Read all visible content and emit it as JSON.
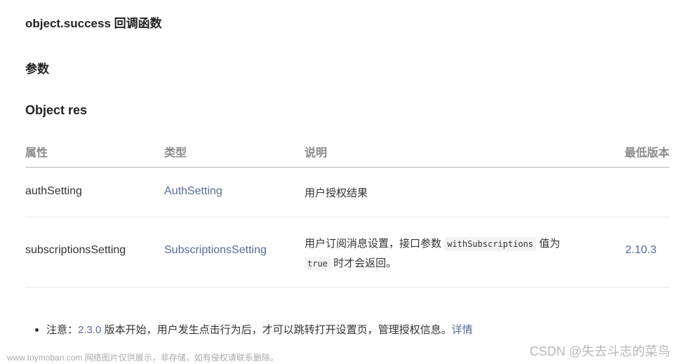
{
  "headings": {
    "callback": "object.success 回调函数",
    "params": "参数",
    "object": "Object res"
  },
  "table": {
    "headers": [
      "属性",
      "类型",
      "说明",
      "最低版本"
    ],
    "rows": [
      {
        "name": "authSetting",
        "type": "AuthSetting",
        "desc": "用户授权结果",
        "version": ""
      },
      {
        "name": "subscriptionsSetting",
        "type": "SubscriptionsSetting",
        "desc_part1": "用户订阅消息设置，接口参数",
        "desc_code1": "withSubscriptions",
        "desc_part2": "值为",
        "desc_code2": "true",
        "desc_part3": "时才会返回。",
        "version": "2.10.3"
      }
    ]
  },
  "note": {
    "prefix": "注意：",
    "version_link": "2.3.0",
    "text": "版本开始，用户发生点击行为后，才可以跳转打开设置页，管理授权信息。",
    "detail_link": "详情"
  },
  "watermarks": {
    "left": "www.toymoban.com 网络图片仅供展示，非存储，如有侵权请联系删除。",
    "right": "CSDN @失去斗志的菜鸟"
  },
  "colors": {
    "link": "#576b95",
    "header_text": "#8a8a8a",
    "body_text": "#333333"
  }
}
